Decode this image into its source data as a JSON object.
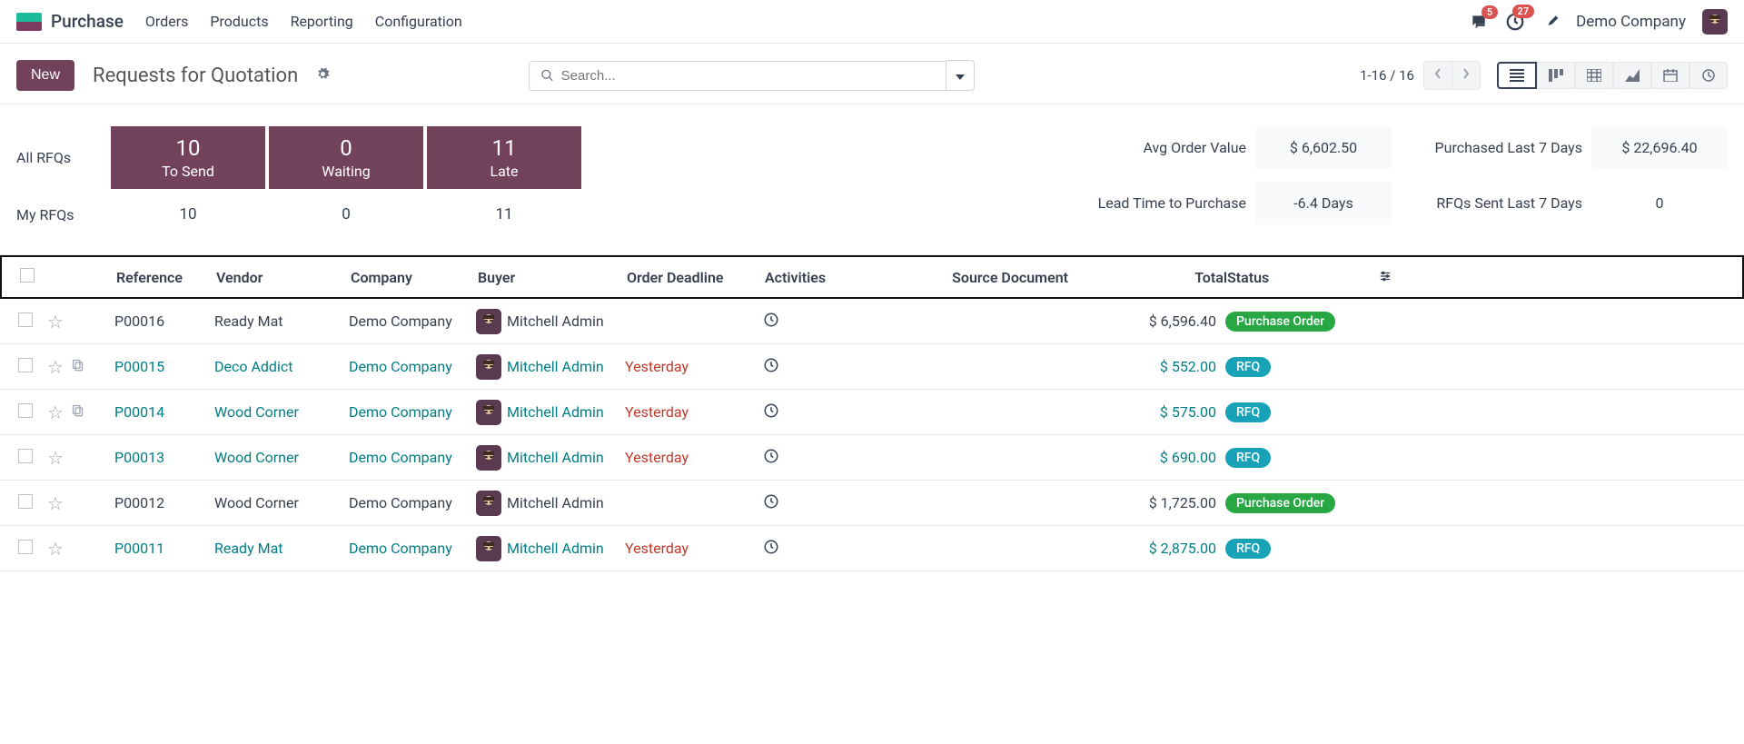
{
  "topbar": {
    "app": "Purchase",
    "menu": [
      "Orders",
      "Products",
      "Reporting",
      "Configuration"
    ],
    "msg_badge": "5",
    "clock_badge": "27",
    "company": "Demo Company"
  },
  "controls": {
    "new_btn": "New",
    "title": "Requests for Quotation",
    "search_placeholder": "Search...",
    "pager": "1-16 / 16"
  },
  "summary": {
    "row1_label": "All RFQs",
    "row2_label": "My RFQs",
    "cards_row1": [
      {
        "num": "10",
        "lbl": "To Send"
      },
      {
        "num": "0",
        "lbl": "Waiting"
      },
      {
        "num": "11",
        "lbl": "Late"
      }
    ],
    "cards_row2": [
      "10",
      "0",
      "11"
    ],
    "stats": {
      "avg_label": "Avg Order Value",
      "avg_val": "$ 6,602.50",
      "purch7_label": "Purchased Last 7 Days",
      "purch7_val": "$ 22,696.40",
      "lead_label": "Lead Time to Purchase",
      "lead_val": "-6.4 Days",
      "sent7_label": "RFQs Sent Last 7 Days",
      "sent7_val": "0"
    }
  },
  "table": {
    "headers": {
      "reference": "Reference",
      "vendor": "Vendor",
      "company": "Company",
      "buyer": "Buyer",
      "deadline": "Order Deadline",
      "activities": "Activities",
      "source": "Source Document",
      "total": "Total",
      "status": "Status"
    },
    "rows": [
      {
        "ref": "P00016",
        "vendor": "Ready Mat",
        "company": "Demo Company",
        "buyer": "Mitchell Admin",
        "deadline": "",
        "deadline_late": false,
        "total": "$ 6,596.40",
        "status": "Purchase Order",
        "status_type": "po",
        "links": false,
        "copy": false
      },
      {
        "ref": "P00015",
        "vendor": "Deco Addict",
        "company": "Demo Company",
        "buyer": "Mitchell Admin",
        "deadline": "Yesterday",
        "deadline_late": true,
        "total": "$ 552.00",
        "status": "RFQ",
        "status_type": "rfq",
        "links": true,
        "copy": true
      },
      {
        "ref": "P00014",
        "vendor": "Wood Corner",
        "company": "Demo Company",
        "buyer": "Mitchell Admin",
        "deadline": "Yesterday",
        "deadline_late": true,
        "total": "$ 575.00",
        "status": "RFQ",
        "status_type": "rfq",
        "links": true,
        "copy": true
      },
      {
        "ref": "P00013",
        "vendor": "Wood Corner",
        "company": "Demo Company",
        "buyer": "Mitchell Admin",
        "deadline": "Yesterday",
        "deadline_late": true,
        "total": "$ 690.00",
        "status": "RFQ",
        "status_type": "rfq",
        "links": true,
        "copy": false
      },
      {
        "ref": "P00012",
        "vendor": "Wood Corner",
        "company": "Demo Company",
        "buyer": "Mitchell Admin",
        "deadline": "",
        "deadline_late": false,
        "total": "$ 1,725.00",
        "status": "Purchase Order",
        "status_type": "po",
        "links": false,
        "copy": false
      },
      {
        "ref": "P00011",
        "vendor": "Ready Mat",
        "company": "Demo Company",
        "buyer": "Mitchell Admin",
        "deadline": "Yesterday",
        "deadline_late": true,
        "total": "$ 2,875.00",
        "status": "RFQ",
        "status_type": "rfq",
        "links": true,
        "copy": false
      }
    ]
  }
}
